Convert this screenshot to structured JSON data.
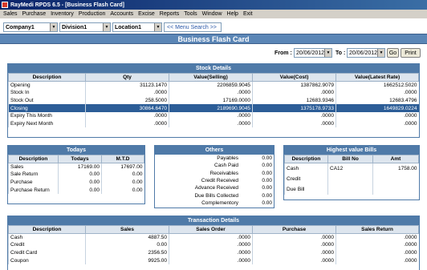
{
  "window": {
    "title": "RayMedi RPDS 6.5 - [Business Flash Card]"
  },
  "menu": [
    "Sales",
    "Purchase",
    "Inventory",
    "Production",
    "Accounts",
    "Excise",
    "Reports",
    "Tools",
    "Window",
    "Help",
    "Exit"
  ],
  "filters": {
    "company": "Company1",
    "division": "Division1",
    "location": "Location1",
    "search_label": "<< Menu Search >>"
  },
  "page": {
    "heading": "Business Flash Card"
  },
  "dates": {
    "from_label": "From :",
    "from_value": "20/06/2012",
    "to_label": "To :",
    "to_value": "20/06/2012",
    "go_label": "Go",
    "print_label": "Print"
  },
  "stock": {
    "title": "Stock Details",
    "columns": [
      "Description",
      "Qty",
      "Value(Selling)",
      "Value(Cost)",
      "Value(Latest Rate)"
    ],
    "rows": [
      [
        "Opening",
        "31123.1470",
        "2206859.9045",
        "1387862.9079",
        "1662512.5020"
      ],
      [
        "Stock In",
        ".0000",
        ".0000",
        ".0000",
        ".0000"
      ],
      [
        "Stock Out",
        "258.5000",
        "17169.0000",
        "12683.9346",
        "12683.4796"
      ],
      [
        "Closing",
        "30864.6470",
        "2189690.9045",
        "1375178.9733",
        "1649829.0224"
      ],
      [
        "Expiry This Month",
        ".0000",
        ".0000",
        ".0000",
        ".0000"
      ],
      [
        "Expiry Next Month",
        ".0000",
        ".0000",
        ".0000",
        ".0000"
      ]
    ]
  },
  "todays": {
    "title": "Todays",
    "columns": [
      "Description",
      "Todays",
      "M.T.D"
    ],
    "rows": [
      [
        "Sales",
        "17169.00",
        "17697.00"
      ],
      [
        "Sale Return",
        "0.00",
        "0.00"
      ],
      [
        "Purchase",
        "0.00",
        "0.00"
      ],
      [
        "Purchase Return",
        "0.00",
        "0.00"
      ]
    ]
  },
  "others": {
    "title": "Others",
    "rows": [
      [
        "Payables",
        "0.00"
      ],
      [
        "Cash Paid",
        "0.00"
      ],
      [
        "Receivables",
        "0.00"
      ],
      [
        "Credit Received",
        "0.00"
      ],
      [
        "Advance Received",
        "0.00"
      ],
      [
        "Due Bills Collected",
        "0.00"
      ],
      [
        "Complementory",
        "0.00"
      ]
    ]
  },
  "highest": {
    "title": "Highest value Bills",
    "columns": [
      "Description",
      "Bill No",
      "Amt"
    ],
    "rows": [
      [
        "Cash",
        "CA12",
        "1758.00"
      ],
      [
        "Credit",
        "",
        ""
      ],
      [
        "Due Bill",
        "",
        ""
      ]
    ]
  },
  "transactions": {
    "title": "Transaction Details",
    "columns": [
      "Description",
      "Sales",
      "Sales Order",
      "Purchase",
      "Sales Return"
    ],
    "rows": [
      [
        "Cash",
        "4887.50",
        ".0000",
        ".0000",
        ".0000"
      ],
      [
        "Credit",
        "0.00",
        ".0000",
        ".0000",
        ".0000"
      ],
      [
        "Credit Card",
        "2356.50",
        ".0000",
        ".0000",
        ".0000"
      ],
      [
        "Coupon",
        "9925.00",
        ".0000",
        ".0000",
        ".0000"
      ]
    ]
  }
}
